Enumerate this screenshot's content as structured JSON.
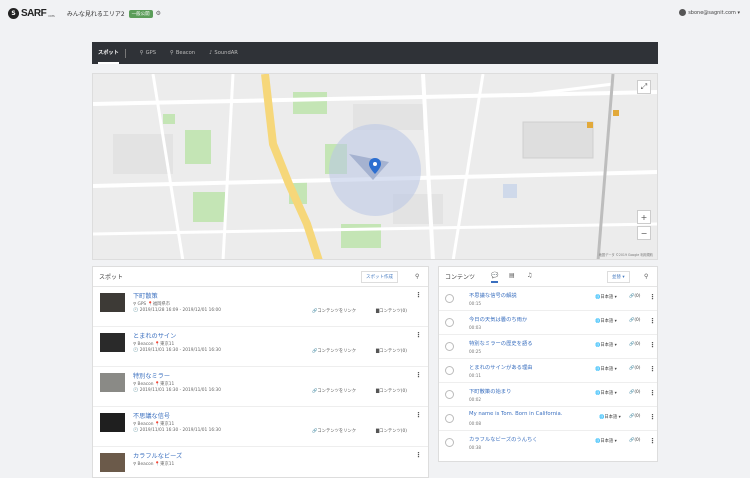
{
  "header": {
    "logo_mark": "S",
    "logo_text": "SARF",
    "logo_sub": "CMS",
    "area_title": "みんな見れるエリア2",
    "badge": "一般公開",
    "gear_glyph": "⚙",
    "user_email": "sbone@sagnit.com ▾"
  },
  "tabs": [
    {
      "label": "スポット",
      "icon": ""
    },
    {
      "label": "GPS",
      "icon": "⚲"
    },
    {
      "label": "Beacon",
      "icon": "⚲"
    },
    {
      "label": "SoundAR",
      "icon": "♪"
    }
  ],
  "map": {
    "zoom_in": "+",
    "zoom_out": "−",
    "fullscreen": "⤢",
    "credit": "地図データ ©2019 Google 利用規約"
  },
  "spots_panel": {
    "title": "スポット",
    "create_button": "スポット作成",
    "search_glyph": "⚲",
    "link_label": "🔗コンテンツをリンク",
    "contents_label": "▇コンテンツ(0)",
    "kebab": "⋮",
    "items": [
      {
        "title": "下町散策",
        "type": "⚲ GPS   📍福岡県市",
        "date": "🕐 2019/11/28 16:09 - 2019/12/01 16:00"
      },
      {
        "title": "とまれのサイン",
        "type": "⚲ Beacon   📍東京11",
        "date": "🕐 2019/11/01 16:30 - 2019/11/01 16:30"
      },
      {
        "title": "特別なミラー",
        "type": "⚲ Beacon   📍東京11",
        "date": "🕐 2019/11/01 16:30 - 2019/11/01 16:30"
      },
      {
        "title": "不思議な信号",
        "type": "⚲ Beacon   📍東京11",
        "date": "🕐 2019/11/01 16:30 - 2019/11/01 16:30"
      },
      {
        "title": "カラフルなビーズ",
        "type": "⚲ Beacon   📍東京11",
        "date": ""
      }
    ]
  },
  "contents_panel": {
    "title": "コンテンツ",
    "tab_icons": [
      "💬",
      "▤",
      "♫"
    ],
    "sort_button": "並替 ▾",
    "search_glyph": "⚲",
    "kebab": "⋮",
    "items": [
      {
        "title": "不思議な信号の解説",
        "time": "00:15",
        "lang": "🌐日本語 ▾",
        "link": "🔗(0)"
      },
      {
        "title": "今日の天気は曇のち雨か",
        "time": "00:03",
        "lang": "🌐日本語 ▾",
        "link": "🔗(0)"
      },
      {
        "title": "特別なミラーの歴史を語る",
        "time": "00:25",
        "lang": "🌐日本語 ▾",
        "link": "🔗(0)"
      },
      {
        "title": "とまれのサインがある理由",
        "time": "00:11",
        "lang": "🌐日本語 ▾",
        "link": "🔗(0)"
      },
      {
        "title": "下町散策の始まり",
        "time": "00:02",
        "lang": "🌐日本語 ▾",
        "link": "🔗(0)"
      },
      {
        "title": "My name is Tom. Born in California.",
        "time": "00:08",
        "lang": "🌐日本語 ▾",
        "link": "🔗(0)"
      },
      {
        "title": "カラフルなビーズのうんちく",
        "time": "00:38",
        "lang": "🌐日本語 ▾",
        "link": "🔗(0)"
      }
    ]
  },
  "colors": {
    "accent": "#3a6fbf",
    "tabbar": "#2f3237",
    "badge": "#5b9d59",
    "park_green": "#bfe3b0",
    "road_yellow": "#f6d77a"
  }
}
